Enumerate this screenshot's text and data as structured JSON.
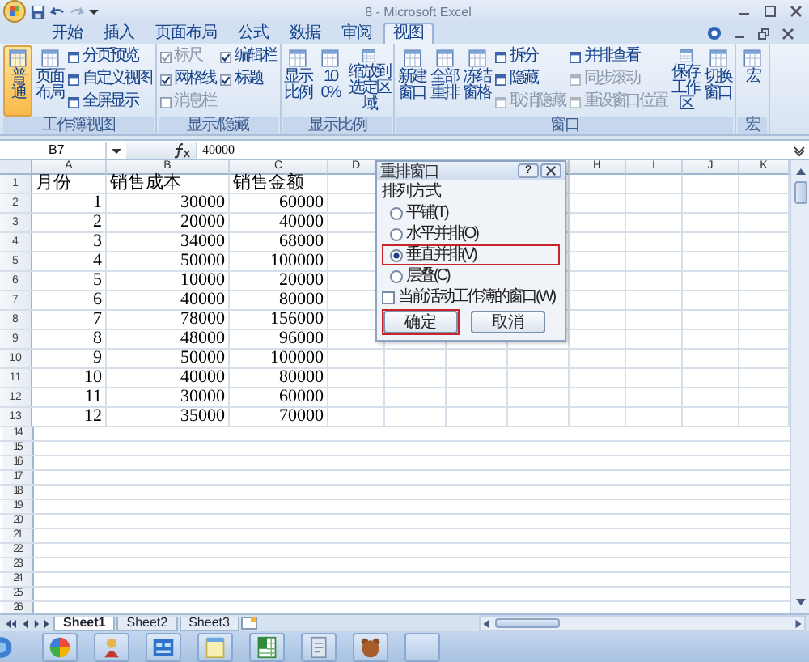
{
  "window": {
    "title": "8 - Microsoft Excel"
  },
  "tabs": [
    {
      "label": "开始",
      "selected": false
    },
    {
      "label": "插入",
      "selected": false
    },
    {
      "label": "页面布局",
      "selected": false
    },
    {
      "label": "公式",
      "selected": false
    },
    {
      "label": "数据",
      "selected": false
    },
    {
      "label": "审阅",
      "selected": false
    },
    {
      "label": "视图",
      "selected": true
    }
  ],
  "ribbon": {
    "groups": [
      {
        "label": "工作簿视图",
        "columns": [
          [
            {
              "kind": "large",
              "label": "普通",
              "selected": true,
              "disabled": false
            }
          ],
          [
            {
              "kind": "large",
              "label": "页面布局",
              "selected": false,
              "disabled": false
            }
          ],
          [
            {
              "kind": "small",
              "label": "分页预览",
              "selected": false,
              "disabled": false
            },
            {
              "kind": "small",
              "label": "自定义视图",
              "selected": false,
              "disabled": false
            },
            {
              "kind": "small",
              "label": "全屏显示",
              "selected": false,
              "disabled": false
            }
          ]
        ]
      },
      {
        "label": "显示/隐藏",
        "columns": [
          [
            {
              "kind": "check",
              "label": "标尺",
              "checked": true,
              "disabled": true
            },
            {
              "kind": "check",
              "label": "网格线",
              "checked": true,
              "disabled": false
            },
            {
              "kind": "check",
              "label": "消息栏",
              "checked": false,
              "disabled": true
            }
          ],
          [
            {
              "kind": "check",
              "label": "编辑栏",
              "checked": true,
              "disabled": false
            },
            {
              "kind": "check",
              "label": "标题",
              "checked": true,
              "disabled": false
            }
          ]
        ]
      },
      {
        "label": "显示比例",
        "columns": [
          [
            {
              "kind": "large",
              "label": "显示比例",
              "disabled": false
            }
          ],
          [
            {
              "kind": "large",
              "label": "100%",
              "disabled": false
            }
          ],
          [
            {
              "kind": "large",
              "label": "缩放到选定区域",
              "disabled": false
            }
          ]
        ]
      },
      {
        "label": "窗口",
        "columns": [
          [
            {
              "kind": "large",
              "label": "新建窗口",
              "disabled": false
            }
          ],
          [
            {
              "kind": "large",
              "label": "全部重排",
              "disabled": false
            }
          ],
          [
            {
              "kind": "large",
              "label": "冻结窗格",
              "disabled": false
            }
          ],
          [
            {
              "kind": "small",
              "label": "拆分",
              "disabled": false
            },
            {
              "kind": "small",
              "label": "隐藏",
              "disabled": false
            },
            {
              "kind": "small",
              "label": "取消隐藏",
              "disabled": true
            }
          ],
          [
            {
              "kind": "small",
              "label": "并排查看",
              "disabled": false
            },
            {
              "kind": "small",
              "label": "同步滚动",
              "disabled": true
            },
            {
              "kind": "small",
              "label": "重设窗口位置",
              "disabled": true
            }
          ],
          [
            {
              "kind": "large",
              "label": "保存工作区",
              "disabled": false
            }
          ],
          [
            {
              "kind": "large",
              "label": "切换窗口",
              "disabled": false
            }
          ]
        ]
      },
      {
        "label": "宏",
        "columns": [
          [
            {
              "kind": "large",
              "label": "宏",
              "disabled": false
            }
          ]
        ]
      }
    ]
  },
  "formula_bar": {
    "name_box": "B7",
    "formula": "40000"
  },
  "sheet": {
    "columns_left": [
      "A",
      "B",
      "C",
      "D"
    ],
    "columns_right": [
      "H",
      "I",
      "J",
      "K"
    ],
    "rows": [
      {
        "number": "1",
        "kind": "text",
        "cells": [
          "月份",
          "销售成本",
          "销售金额"
        ]
      },
      {
        "number": "2",
        "kind": "number",
        "cells": [
          "1",
          "30000",
          "60000"
        ]
      },
      {
        "number": "3",
        "kind": "number",
        "cells": [
          "2",
          "20000",
          "40000"
        ]
      },
      {
        "number": "4",
        "kind": "number",
        "cells": [
          "3",
          "34000",
          "68000"
        ]
      },
      {
        "number": "5",
        "kind": "number",
        "cells": [
          "4",
          "50000",
          "100000"
        ]
      },
      {
        "number": "6",
        "kind": "number",
        "cells": [
          "5",
          "10000",
          "20000"
        ]
      },
      {
        "number": "7",
        "kind": "number",
        "cells": [
          "6",
          "40000",
          "80000"
        ]
      },
      {
        "number": "8",
        "kind": "number",
        "cells": [
          "7",
          "78000",
          "156000"
        ]
      },
      {
        "number": "9",
        "kind": "number",
        "cells": [
          "8",
          "48000",
          "96000"
        ]
      },
      {
        "number": "10",
        "kind": "number",
        "cells": [
          "9",
          "50000",
          "100000"
        ]
      },
      {
        "number": "11",
        "kind": "number",
        "cells": [
          "10",
          "40000",
          "80000"
        ]
      },
      {
        "number": "12",
        "kind": "number",
        "cells": [
          "11",
          "30000",
          "60000"
        ]
      },
      {
        "number": "13",
        "kind": "number",
        "cells": [
          "12",
          "35000",
          "70000"
        ]
      }
    ],
    "empty_rows": [
      "14",
      "15",
      "16",
      "17",
      "18",
      "19",
      "20",
      "21",
      "22",
      "23",
      "24",
      "25",
      "26"
    ],
    "sheets": [
      {
        "label": "Sheet1",
        "selected": true
      },
      {
        "label": "Sheet2",
        "selected": false
      },
      {
        "label": "Sheet3",
        "selected": false
      }
    ]
  },
  "dialog": {
    "title": "重排窗口",
    "help": "?",
    "group_label": "排列方式",
    "options": [
      {
        "label": "平铺(T)",
        "selected": false,
        "highlighted": false
      },
      {
        "label": "水平并排(O)",
        "selected": false,
        "highlighted": false
      },
      {
        "label": "垂直并排(V)",
        "selected": true,
        "highlighted": true
      },
      {
        "label": "层叠(C)",
        "selected": false,
        "highlighted": false
      }
    ],
    "checkbox": {
      "label": "当前活动工作簿的窗口(W)",
      "checked": false
    },
    "buttons": [
      {
        "label": "确定",
        "highlighted": true
      },
      {
        "label": "取消",
        "highlighted": false
      }
    ]
  }
}
